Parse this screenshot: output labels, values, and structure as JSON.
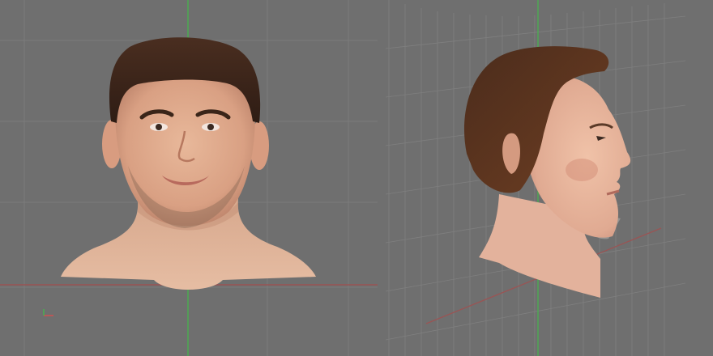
{
  "window": {
    "title": ""
  },
  "viewports": [
    {
      "id": "front",
      "view": "front"
    },
    {
      "id": "side",
      "view": "right"
    }
  ],
  "axis_gizmo": {
    "label": ""
  },
  "colors": {
    "background": "#6f6f6f",
    "grid_line": "#7c7c7c",
    "axis_x": "#a05050",
    "axis_y": "#4caf50",
    "skin": "#e4b69a",
    "hair": "#3b2418"
  },
  "icons": [
    "axis-gizmo-icon"
  ]
}
